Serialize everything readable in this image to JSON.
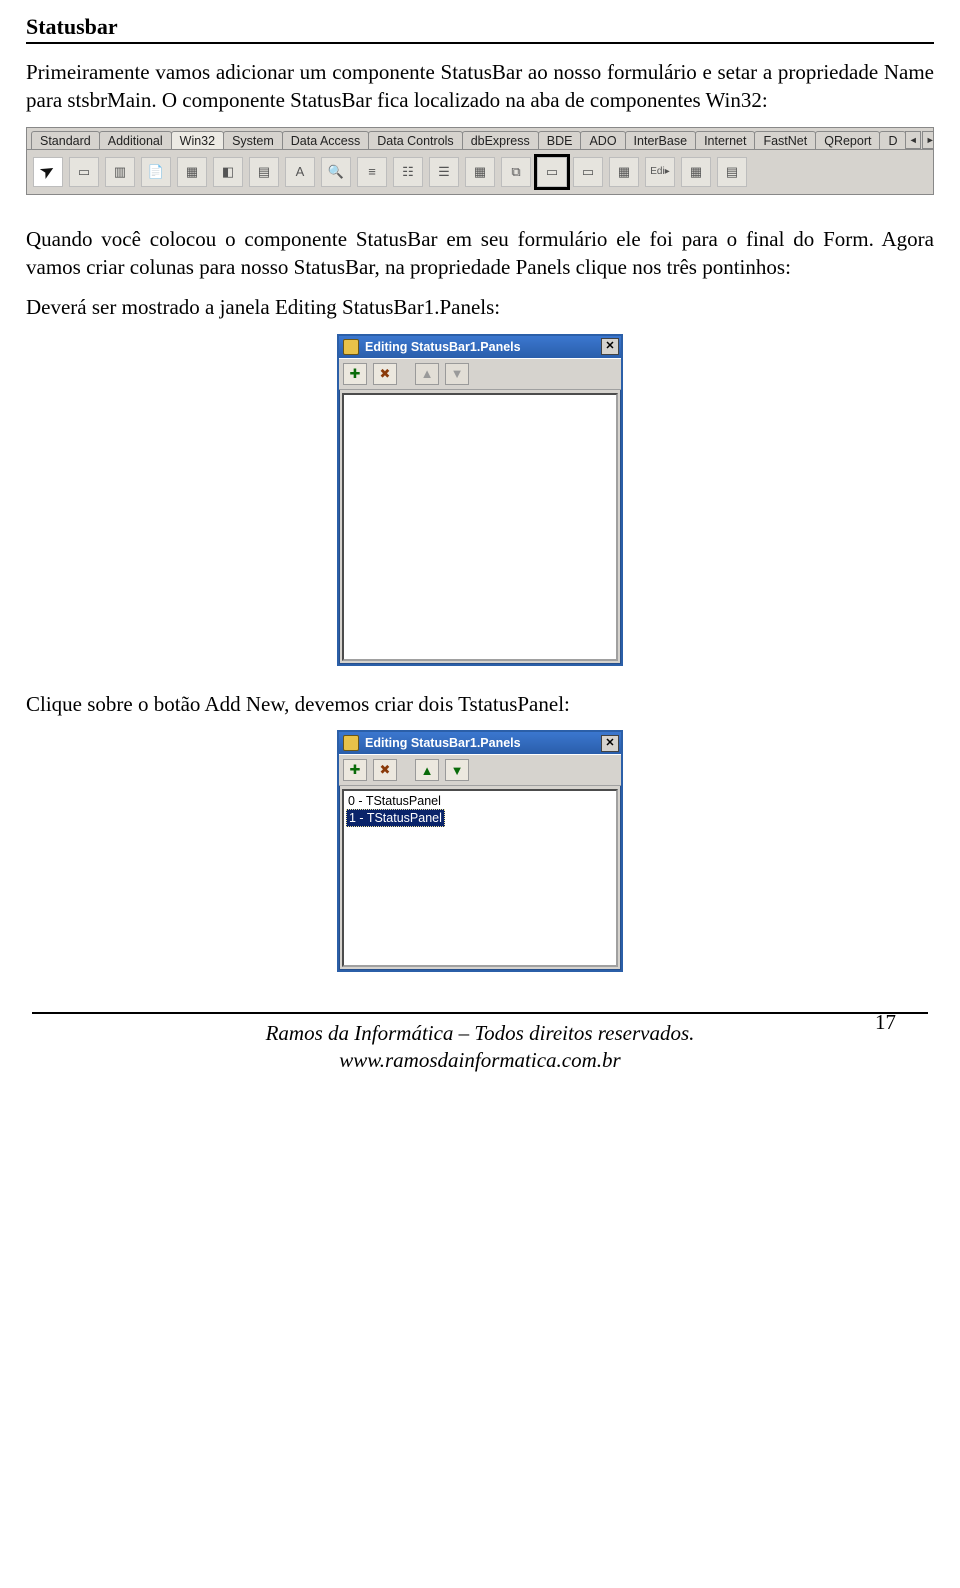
{
  "heading": "Statusbar",
  "para1": "Primeiramente vamos adicionar um componente StatusBar ao nosso formulário e setar a propriedade Name para stsbrMain. O componente StatusBar fica localizado na aba de componentes Win32:",
  "palette": {
    "tabs": [
      "Standard",
      "Additional",
      "Win32",
      "System",
      "Data Access",
      "Data Controls",
      "dbExpress",
      "BDE",
      "ADO",
      "InterBase",
      "Internet",
      "FastNet",
      "QReport",
      "D"
    ],
    "active_tab_index": 2
  },
  "para2": "Quando você colocou o componente StatusBar em seu formulário ele foi para o final do Form. Agora vamos criar colunas para nosso StatusBar, na propriedade Panels clique nos três pontinhos:",
  "para3": "Deverá ser mostrado a janela Editing StatusBar1.Panels:",
  "dialog1": {
    "title": "Editing StatusBar1.Panels",
    "items": []
  },
  "para4": "Clique sobre o botão Add New, devemos criar dois TstatusPanel:",
  "dialog2": {
    "title": "Editing StatusBar1.Panels",
    "items": [
      "0 - TStatusPanel",
      "1 - TStatusPanel"
    ],
    "selected_index": 1
  },
  "page_number": "17",
  "footer_line1": "Ramos da Informática – Todos direitos reservados.",
  "footer_line2": "www.ramosdainformatica.com.br"
}
